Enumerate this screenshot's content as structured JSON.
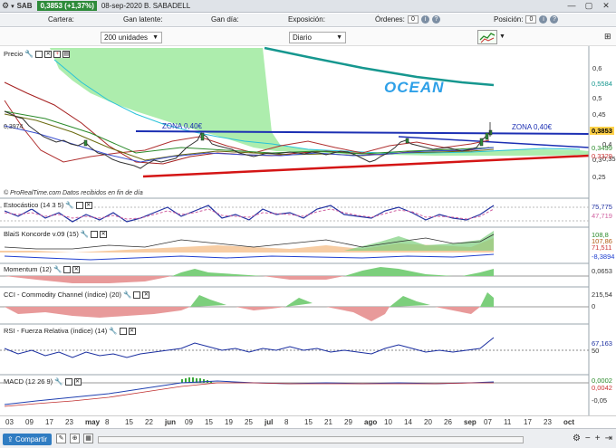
{
  "titlebar": {
    "symbol": "SAB",
    "price_change": "0,3853 (+1,37%)",
    "date_name": "08-sep-2020  B. SABADELL"
  },
  "toolbar": {
    "cartera": "Cartera:",
    "ganancia_latente": "Gan latente:",
    "ganancia_dia": "Gan día:",
    "exposicion": "Exposición:",
    "ordenes": "Órdenes:",
    "ordenes_val": "0",
    "posicion": "Posición:",
    "posicion_val": "0"
  },
  "controls": {
    "units": "200 unidades",
    "period": "Diario"
  },
  "panels": {
    "price": "Precio",
    "stoch": "Estocástico (14 3 5)",
    "koncorde": "BlaiS Koncorde v.09 (15)",
    "momentum": "Momentum (12)",
    "cci": "CCI - Commodity Channel (índice) (20)",
    "rsi": "RSI - Fuerza Relativa (índice) (14)",
    "macd": "MACD (12 26 9)"
  },
  "annotations": {
    "ocean": "OCEAN",
    "zona_left": "ZONA 0,40€",
    "zona_right": "ZONA 0,40€",
    "credit": "© ProRealTime.com  Datos recibidos en fin de día",
    "left_price": "0,3974"
  },
  "price_axis": [
    "0,6",
    "0,5",
    "0,45",
    "0,4",
    "0,35",
    "0,3",
    "0,25"
  ],
  "price_tags": {
    "top": "0,5584",
    "current": "0,3853",
    "t2": "0,3499",
    "t3": "0,3329"
  },
  "indicator_values": {
    "stoch": [
      "75,775",
      "47,719"
    ],
    "koncorde": [
      "108,8",
      "107,86",
      "71,511",
      "-8,3894"
    ],
    "momentum": [
      "0,0653"
    ],
    "cci": [
      "215,54",
      "0"
    ],
    "rsi": [
      "67,163",
      "50"
    ],
    "macd": [
      "0,0002",
      "0,0042",
      "-0,05"
    ]
  },
  "x_axis": [
    {
      "label": "03",
      "month": false
    },
    {
      "label": "09",
      "month": false
    },
    {
      "label": "17",
      "month": false
    },
    {
      "label": "23",
      "month": false
    },
    {
      "label": "may",
      "month": true
    },
    {
      "label": "8",
      "month": false
    },
    {
      "label": "15",
      "month": false
    },
    {
      "label": "22",
      "month": false
    },
    {
      "label": "jun",
      "month": true
    },
    {
      "label": "09",
      "month": false
    },
    {
      "label": "15",
      "month": false
    },
    {
      "label": "19",
      "month": false
    },
    {
      "label": "25",
      "month": false
    },
    {
      "label": "jul",
      "month": true
    },
    {
      "label": "8",
      "month": false
    },
    {
      "label": "15",
      "month": false
    },
    {
      "label": "21",
      "month": false
    },
    {
      "label": "29",
      "month": false
    },
    {
      "label": "ago",
      "month": true
    },
    {
      "label": "10",
      "month": false
    },
    {
      "label": "14",
      "month": false
    },
    {
      "label": "20",
      "month": false
    },
    {
      "label": "26",
      "month": false
    },
    {
      "label": "sep",
      "month": true
    },
    {
      "label": "07",
      "month": false
    },
    {
      "label": "11",
      "month": false
    },
    {
      "label": "17",
      "month": false
    },
    {
      "label": "23",
      "month": false
    },
    {
      "label": "oct",
      "month": true
    }
  ],
  "footer": {
    "share": "Compartir"
  },
  "colors": {
    "up": "#2e8b3a",
    "ocean": "#1a9aa0",
    "zona": "#1c2fb3",
    "support": "#d41515",
    "cloud": "#8fe38f"
  }
}
